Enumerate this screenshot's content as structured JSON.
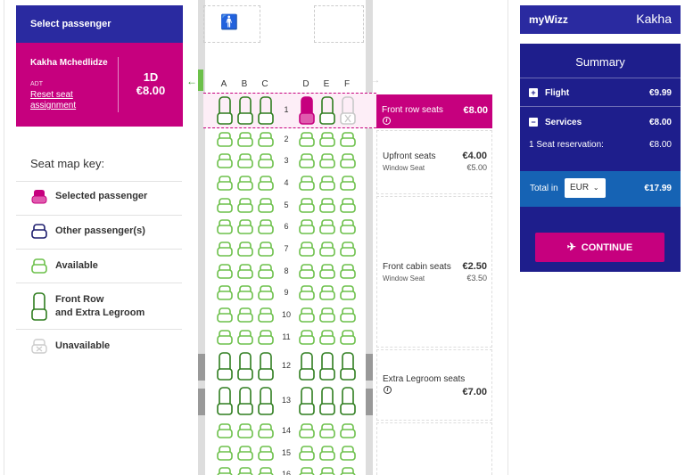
{
  "passenger_panel": {
    "title": "Select passenger",
    "name": "Kakha Mchedlidze",
    "type": "ADT",
    "reset_link": "Reset seat assignment",
    "seat": "1D",
    "seat_price": "€8.00"
  },
  "seat_map_key": {
    "title": "Seat map key:",
    "items": [
      {
        "label": "Selected passenger",
        "icon": "seat-selected-icon"
      },
      {
        "label": "Other passenger(s)",
        "icon": "seat-other-icon"
      },
      {
        "label": "Available",
        "icon": "seat-available-icon"
      },
      {
        "label": "Front Row\nand Extra Legroom",
        "icon": "seat-front-row-icon"
      },
      {
        "label": "Unavailable",
        "icon": "seat-unavailable-icon"
      }
    ]
  },
  "seat_map": {
    "columns": [
      "A",
      "B",
      "C",
      "D",
      "E",
      "F"
    ],
    "rows": [
      "1",
      "2",
      "3",
      "4",
      "5",
      "6",
      "7",
      "8",
      "9",
      "10",
      "11",
      "12",
      "13",
      "14",
      "15",
      "16"
    ],
    "selected_seat": "1D",
    "unavailable_seats": [
      "1F"
    ]
  },
  "zones": {
    "front": {
      "name": "Front row seats",
      "price": "€8.00"
    },
    "upfront": {
      "name": "Upfront seats",
      "price": "€4.00",
      "sub": "Window Seat",
      "sub_price": "€5.00"
    },
    "cabin": {
      "name": "Front cabin seats",
      "price": "€2.50",
      "sub": "Window Seat",
      "sub_price": "€3.50"
    },
    "legroom": {
      "name": "Extra Legroom seats",
      "price": "€7.00"
    }
  },
  "account": {
    "logo": "myWizz",
    "user": "Kakha"
  },
  "summary": {
    "title": "Summary",
    "flight_label": "Flight",
    "flight_price": "€9.99",
    "services_label": "Services",
    "services_price": "€8.00",
    "seat_reservation_label": "1 Seat reservation:",
    "seat_reservation_price": "€8.00",
    "total_label": "Total in",
    "currency": "EUR",
    "total_amount": "€17.99",
    "continue_label": "CONTINUE"
  },
  "colors": {
    "brand_purple": "#2a2aa0",
    "brand_magenta": "#c6007e",
    "seat_available": "#6cc04a",
    "seat_front_row": "#2e7d1e",
    "total_bar": "#1663b4"
  }
}
